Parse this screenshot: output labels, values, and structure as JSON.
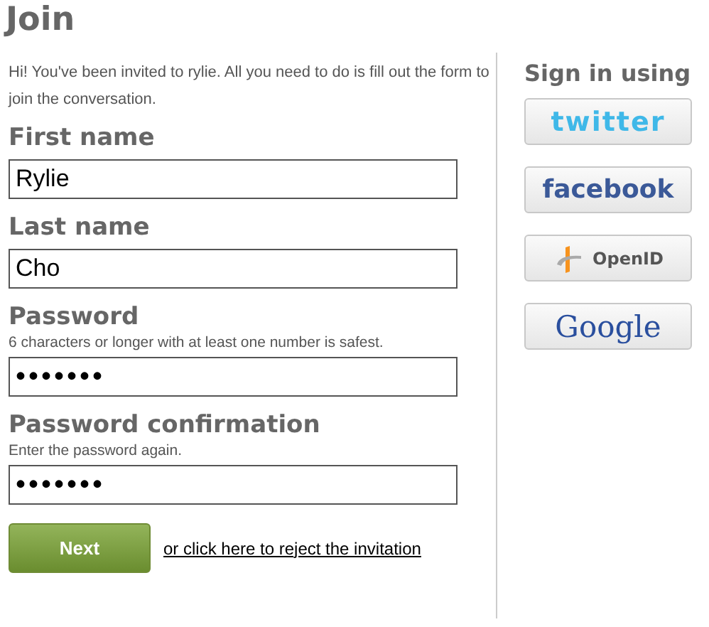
{
  "title": "Join",
  "intro": "Hi! You've been invited to rylie. All you need to do is fill out the form to join the conversation.",
  "fields": [
    {
      "label": "First name",
      "value": "Rylie"
    },
    {
      "label": "Last name",
      "value": "Cho"
    },
    {
      "label": "Password",
      "hint": "6 characters or longer with at least one number is safest.",
      "value": "•••••••"
    },
    {
      "label": "Password confirmation",
      "hint": "Enter the password again.",
      "value": "•••••••"
    }
  ],
  "next_button": "Next",
  "reject_link": "or click here to reject the invitation",
  "sign_in": {
    "heading": "Sign in using",
    "providers": [
      {
        "kind": "twitter",
        "label": "twitter"
      },
      {
        "kind": "facebook",
        "label": "facebook"
      },
      {
        "kind": "openid",
        "label": "OpenID"
      },
      {
        "kind": "google",
        "label": "Google"
      }
    ]
  }
}
